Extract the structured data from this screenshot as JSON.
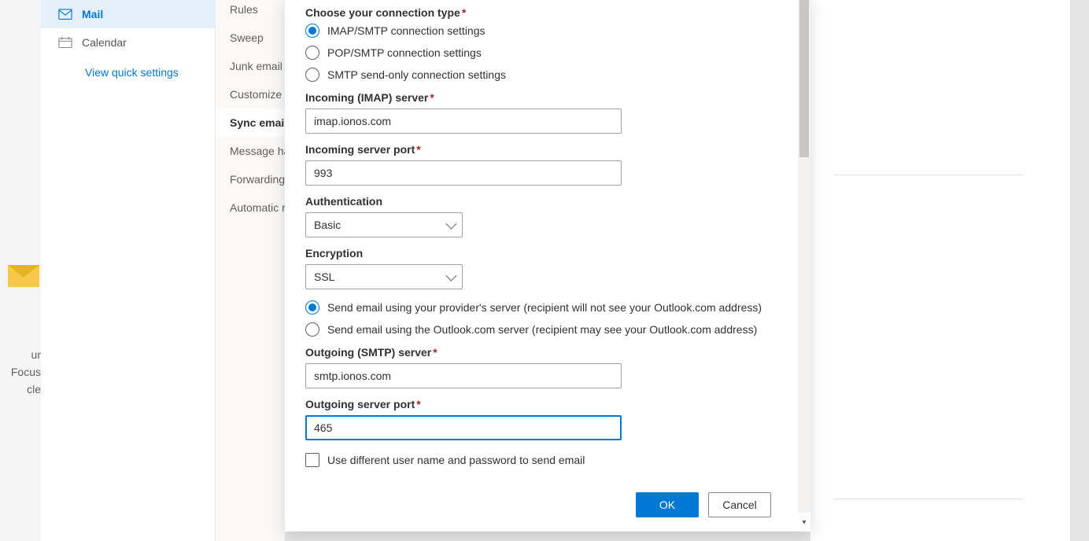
{
  "background": {
    "focus_line1": "ur Focus",
    "focus_line2": "cle"
  },
  "nav": {
    "mail": "Mail",
    "calendar": "Calendar",
    "quick": "View quick settings"
  },
  "subnav": {
    "rules": "Rules",
    "sweep": "Sweep",
    "junk": "Junk email",
    "customize": "Customize a",
    "sync": "Sync email",
    "msg_handling": "Message ha",
    "forwarding": "Forwarding",
    "automatic": "Automatic r"
  },
  "form": {
    "connection_type_label": "Choose your connection type",
    "opt_imap": "IMAP/SMTP connection settings",
    "opt_pop": "POP/SMTP connection settings",
    "opt_smtp_only": "SMTP send-only connection settings",
    "incoming_server_label": "Incoming (IMAP) server",
    "incoming_server_value": "imap.ionos.com",
    "incoming_port_label": "Incoming server port",
    "incoming_port_value": "993",
    "auth_label": "Authentication",
    "auth_value": "Basic",
    "enc_label": "Encryption",
    "enc_value": "SSL",
    "send_provider": "Send email using your provider's server (recipient will not see your Outlook.com address)",
    "send_outlook": "Send email using the Outlook.com server (recipient may see your Outlook.com address)",
    "outgoing_server_label": "Outgoing (SMTP) server",
    "outgoing_server_value": "smtp.ionos.com",
    "outgoing_port_label": "Outgoing server port",
    "outgoing_port_value": "465",
    "diff_creds": "Use different user name and password to send email",
    "ok": "OK",
    "cancel": "Cancel",
    "asterisk": "*"
  }
}
